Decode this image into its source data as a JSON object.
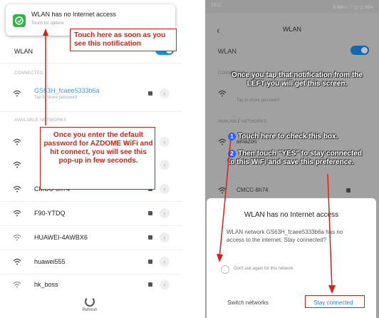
{
  "left": {
    "notification": {
      "title": "WLAN has no Internet access",
      "subtitle": "Touch for options"
    },
    "wlan_label": "WLAN",
    "connected_header": "CONNECTED",
    "connected": {
      "name": "GS63H_fcaee5333b6a",
      "status": "Tap to share password"
    },
    "available_header": "AVAILABLE NETWORKS",
    "networks": [
      "CMCC-8h74",
      "F90-YTDQ",
      "HUAWEI-4AWBX6",
      "huawei555",
      "hk_boss"
    ],
    "refresh_label": "Refresh",
    "annot_top": "Touch here as soon as you see this notification",
    "annot_mid": "Once you enter the default password for AZDOME WiFi and hit connect, you will see this pop-up in few seconds."
  },
  "right": {
    "status_time": "13:22",
    "status_right": "5.88K/s ⓘ ◫ ◫ 86%",
    "back_icon": "back-arrow-icon",
    "title": "WLAN",
    "wlan_label": "WLAN",
    "connected_header": "CONNECTED",
    "connected_status": "Tap to share password",
    "available_header": "AVAILABLE NETWORKS",
    "net_amazon": "amazon",
    "net_cmcc": "CMCC-8h74",
    "annot_top": "Once you tap that notification from the LEFT you will get this screen.",
    "step1": "Touch here to check this box.",
    "step2": "Then touch \"YES\" to stay connected to this WiFi and save this preference.",
    "dialog": {
      "title": "WLAN has no Internet access",
      "body": "WLAN network GS63H_fcaee5333b6a has no access to the internet. Stay connected?",
      "checkbox_label": "Don't ask again for this network",
      "btn_left": "Switch networks",
      "btn_right": "Stay connected"
    },
    "step1_number": "1",
    "step2_number": "2"
  },
  "colors": {
    "red": "#d0251b",
    "blue": "#1e88e5",
    "green": "#36b24a"
  }
}
